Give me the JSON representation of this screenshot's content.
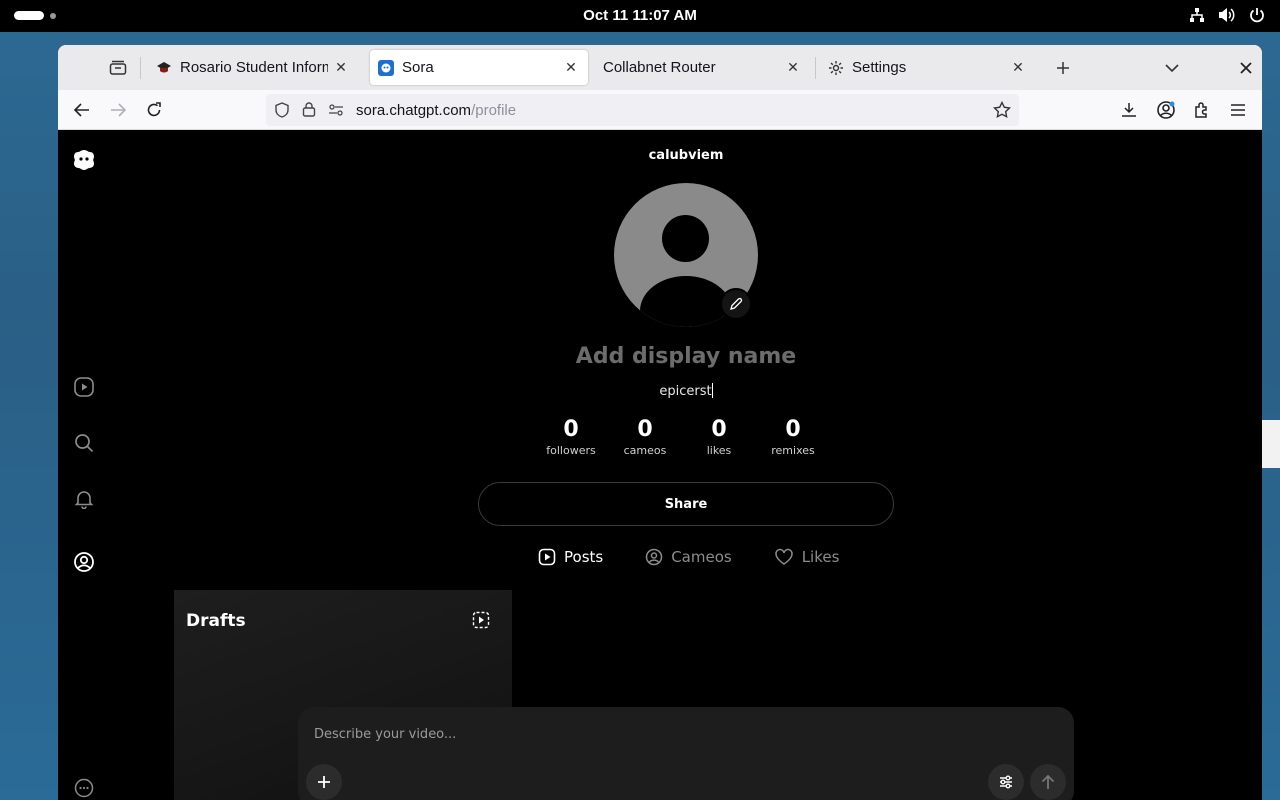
{
  "system": {
    "clock": "Oct 11  11:07 AM"
  },
  "browser": {
    "tabs": [
      {
        "title": "Rosario Student Informati",
        "active": false
      },
      {
        "title": "Sora",
        "active": true
      },
      {
        "title": "Collabnet Router",
        "active": false
      },
      {
        "title": "Settings",
        "active": false
      }
    ],
    "url_host": "sora.chatgpt.com",
    "url_path": "/profile"
  },
  "profile": {
    "username": "calubviem",
    "display_name_placeholder": "Add display name",
    "handle": "epicerst",
    "stats": [
      {
        "value": "0",
        "label": "followers"
      },
      {
        "value": "0",
        "label": "cameos"
      },
      {
        "value": "0",
        "label": "likes"
      },
      {
        "value": "0",
        "label": "remixes"
      }
    ],
    "share_label": "Share",
    "tabs": [
      {
        "label": "Posts",
        "active": true
      },
      {
        "label": "Cameos",
        "active": false
      },
      {
        "label": "Likes",
        "active": false
      }
    ],
    "drafts_title": "Drafts"
  },
  "composer": {
    "placeholder": "Describe your video..."
  },
  "colors": {
    "page_bg": "#000000",
    "tab_bar_bg": "#eaeaed",
    "avatar_gray": "#8a8a8a"
  }
}
